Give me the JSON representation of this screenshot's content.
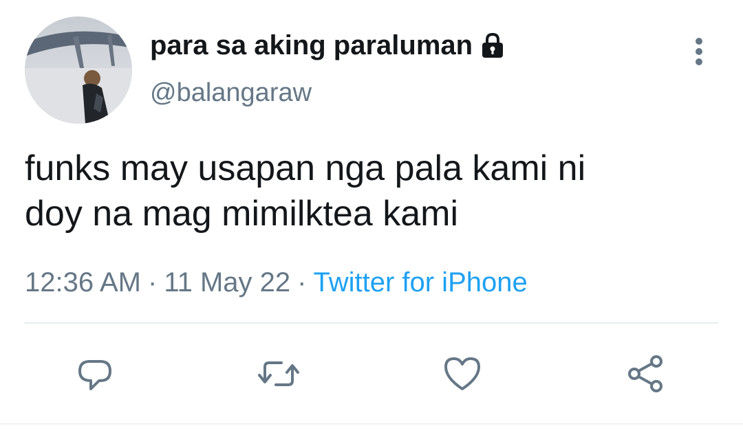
{
  "tweet": {
    "display_name": "para sa aking paraluman",
    "handle": "@balangaraw",
    "text_lines": [
      "funks may usapan nga pala kami ni",
      "doy na mag mimilktea kami"
    ],
    "time": "12:36 AM",
    "separator": "·",
    "date": "11 May 22",
    "source": "Twitter for iPhone"
  },
  "icons": {
    "lock": "lock-icon",
    "more": "more-vertical-icon",
    "reply": "reply-icon",
    "retweet": "retweet-icon",
    "like": "heart-icon",
    "share": "share-icon"
  },
  "colors": {
    "text": "#14171a",
    "secondary": "#657786",
    "link": "#1da1f2",
    "divider": "#e6ecf0"
  }
}
